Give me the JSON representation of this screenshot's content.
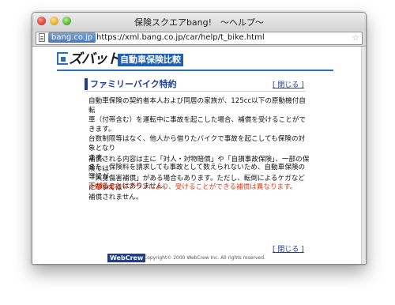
{
  "window": {
    "title": "保険スクエアbang!　～ヘルプ～"
  },
  "address_bar": {
    "site_badge": "bang.co.jp",
    "url": "https://xml.bang.co.jp/car/help/t_bike.html",
    "bookmark_icon": "star-icon"
  },
  "header": {
    "logo_text": "ズバット",
    "logo_badge": "自動車保険比較"
  },
  "section": {
    "title": "ファミリーバイク特約",
    "close_top": "[ 閉じる ]",
    "close_bottom": "[ 閉じる ]"
  },
  "body": {
    "p1_lines": [
      "自動車保険の契約者本人および同居の家族が、125cc以下の原動機付自転",
      "車（付帯含む）を運転中に事故を起こした場合、補償を受けることができます。",
      "台数制限等はなく、他人から借りたバイクで事故を起こしても保険の対象となり",
      "ます。",
      "また、保険料を請求しても事故として数えられないため、自動車保険の等級が",
      "下がることはありません。"
    ],
    "p2_lines": [
      "補償される内容は主に「対人・対物賠償」や「自損事故保険」、一部の保険では",
      "「人身傷害補償」がある場合もあります。ただし、転倒によるケガなどについては",
      "補償されません。"
    ],
    "note": "※保険会社やプランにより、受けることができる補償は異なります。"
  },
  "footer": {
    "brand": "WebCrew",
    "copyright": "Copyright© 2000 WebCrew Inc. All rights reserved."
  },
  "colors": {
    "accent_navy": "#1d3f92",
    "logo_blue": "#1d5fb4",
    "note_red": "#e23c1a"
  }
}
